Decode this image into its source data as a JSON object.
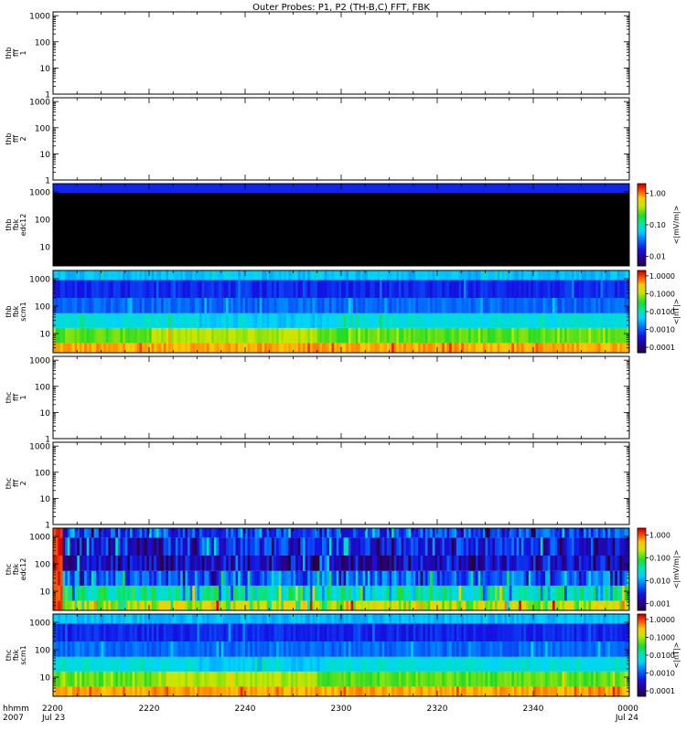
{
  "title": "Outer Probes: P1, P2 (TH-B,C) FFT, FBK",
  "time_axis": {
    "row_labels": [
      "hhmm",
      "2007"
    ],
    "ticks": [
      {
        "t": 0,
        "label": "2200",
        "sub": "Jul 23"
      },
      {
        "t": 20,
        "label": "2220",
        "sub": ""
      },
      {
        "t": 40,
        "label": "2240",
        "sub": ""
      },
      {
        "t": 60,
        "label": "2300",
        "sub": ""
      },
      {
        "t": 80,
        "label": "2320",
        "sub": ""
      },
      {
        "t": 100,
        "label": "2340",
        "sub": ""
      },
      {
        "t": 120,
        "label": "0000",
        "sub": "Jul 24"
      }
    ],
    "range_minutes": [
      0,
      120
    ]
  },
  "chart_data": [
    {
      "type": "heatmap",
      "ylabel": [
        "thb",
        "fff",
        "1"
      ],
      "yscale": "log",
      "ylim": [
        1,
        1400
      ],
      "ytick_labels": [
        "1",
        "10",
        "100",
        "1000"
      ],
      "data": "empty"
    },
    {
      "type": "heatmap",
      "ylabel": [
        "thb",
        "fff",
        "2"
      ],
      "yscale": "log",
      "ylim": [
        1,
        1400
      ],
      "ytick_labels": [
        "1",
        "10",
        "100",
        "1000"
      ],
      "data": "empty"
    },
    {
      "type": "heatmap",
      "ylabel": [
        "thb",
        "fbk",
        "edc12"
      ],
      "yscale": "log",
      "ylim": [
        2,
        2000
      ],
      "ytick_labels": [
        "10",
        "100",
        "1000"
      ],
      "colorbar": {
        "label": "<|mV/m|>",
        "scale": "log",
        "range": [
          0.005,
          2
        ],
        "tick_labels": [
          "0.01",
          "0.10",
          "1.00"
        ]
      },
      "pattern": "black-with-blue-top"
    },
    {
      "type": "heatmap",
      "ylabel": [
        "thb",
        "fbk",
        "scm1"
      ],
      "yscale": "log",
      "ylim": [
        2,
        2000
      ],
      "ytick_labels": [
        "10",
        "100",
        "1000"
      ],
      "colorbar": {
        "label": "<|nT|>",
        "scale": "log",
        "range": [
          5e-05,
          2
        ],
        "tick_labels": [
          "0.0001",
          "0.0010",
          "0.0100",
          "0.1000",
          "1.0000"
        ]
      },
      "pattern": "scm-bands"
    },
    {
      "type": "heatmap",
      "ylabel": [
        "thc",
        "fff",
        "1"
      ],
      "yscale": "log",
      "ylim": [
        1,
        1400
      ],
      "ytick_labels": [
        "1",
        "10",
        "100",
        "1000"
      ],
      "data": "empty"
    },
    {
      "type": "heatmap",
      "ylabel": [
        "thc",
        "fff",
        "2"
      ],
      "yscale": "log",
      "ylim": [
        1,
        1400
      ],
      "ytick_labels": [
        "1",
        "10",
        "100",
        "1000"
      ],
      "data": "empty"
    },
    {
      "type": "heatmap",
      "ylabel": [
        "thc",
        "fbk",
        "edc12"
      ],
      "yscale": "log",
      "ylim": [
        2,
        2000
      ],
      "ytick_labels": [
        "10",
        "100",
        "1000"
      ],
      "colorbar": {
        "label": "<|mV/m|>",
        "scale": "log",
        "range": [
          0.0005,
          2
        ],
        "tick_labels": [
          "0.001",
          "0.010",
          "0.100",
          "1.000"
        ]
      },
      "pattern": "edc-noisy"
    },
    {
      "type": "heatmap",
      "ylabel": [
        "thc",
        "fbk",
        "scm1"
      ],
      "yscale": "log",
      "ylim": [
        2,
        2000
      ],
      "ytick_labels": [
        "10",
        "100",
        "1000"
      ],
      "colorbar": {
        "label": "<|nT|>",
        "scale": "log",
        "range": [
          5e-05,
          2
        ],
        "tick_labels": [
          "0.0001",
          "0.0010",
          "0.0100",
          "0.1000",
          "1.0000"
        ]
      },
      "pattern": "scm-bands"
    }
  ]
}
